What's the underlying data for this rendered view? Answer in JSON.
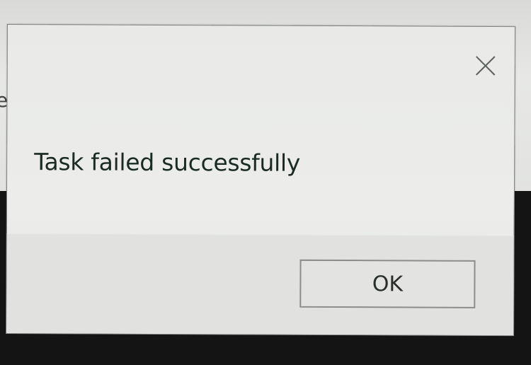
{
  "dialog": {
    "message": "Task failed successfully",
    "ok_label": "OK",
    "close_icon": "close-icon"
  },
  "colors": {
    "dialog_background": "#ecedeb",
    "message_text": "#1b2a23",
    "button_border": "#8a8d8c",
    "desktop_background": "#141414"
  }
}
